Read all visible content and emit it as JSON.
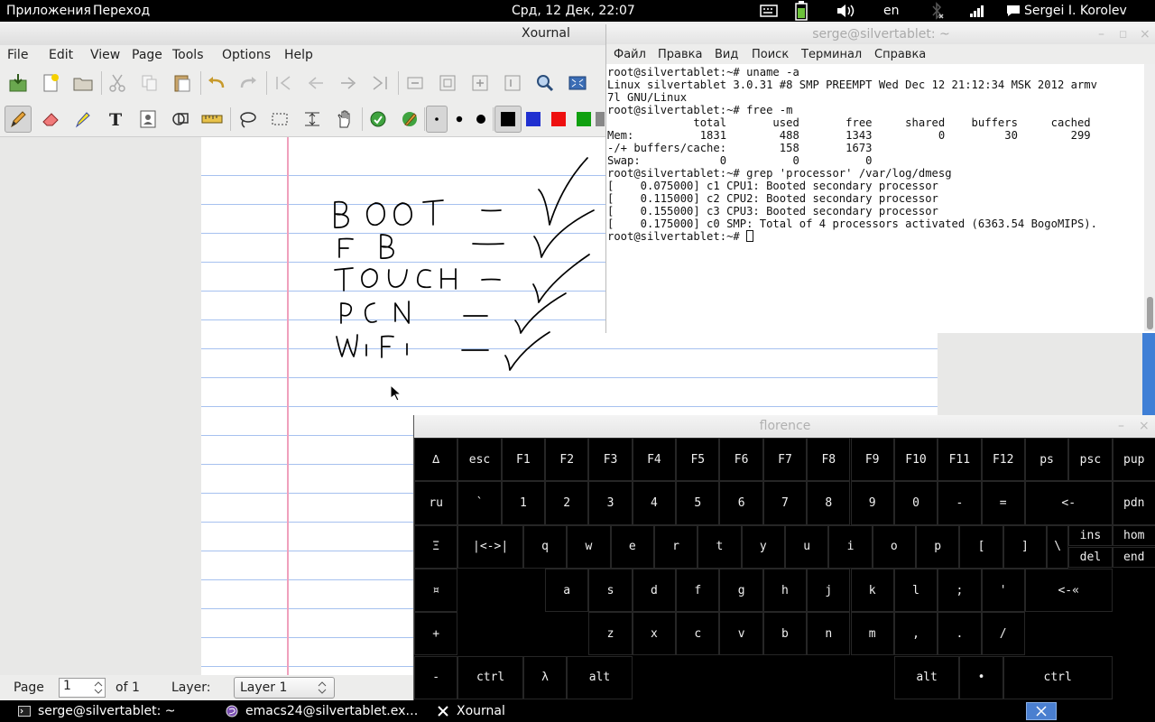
{
  "top_panel": {
    "applications": "Приложения",
    "places": "Переход",
    "clock": "Срд, 12 Дек, 22:07",
    "keyboard_layout": "en",
    "user": "Sergei I. Korolev"
  },
  "xournal": {
    "title": "Xournal",
    "menu": [
      "File",
      "Edit",
      "View",
      "Page",
      "Tools",
      "Options",
      "Help"
    ],
    "status": {
      "page_label": "Page",
      "page_value": "1",
      "of_label": "of 1",
      "layer_label": "Layer:",
      "layer_value": "Layer 1"
    },
    "colors": {
      "pen_black": "#000000",
      "blue": "#2030d0",
      "red": "#ee1010",
      "green": "#10a010"
    }
  },
  "terminal": {
    "title": "serge@silvertablet: ~",
    "menu": [
      "Файл",
      "Правка",
      "Вид",
      "Поиск",
      "Терминал",
      "Справка"
    ],
    "lines": [
      "root@silvertablet:~# uname -a",
      "Linux silvertablet 3.0.31 #8 SMP PREEMPT Wed Dec 12 21:12:34 MSK 2012 armv",
      "7l GNU/Linux",
      "root@silvertablet:~# free -m",
      "             total       used       free     shared    buffers     cached",
      "Mem:          1831        488       1343          0         30        299",
      "-/+ buffers/cache:        158       1673",
      "Swap:            0          0          0",
      "root@silvertablet:~# grep 'processor' /var/log/dmesg",
      "[    0.075000] c1 CPU1: Booted secondary processor",
      "[    0.115000] c2 CPU2: Booted secondary processor",
      "[    0.155000] c3 CPU3: Booted secondary processor",
      "[    0.175000] c0 SMP: Total of 4 processors activated (6363.54 BogoMIPS)."
    ],
    "prompt": "root@silvertablet:~# "
  },
  "florence": {
    "title": "florence",
    "rows": [
      [
        "∆",
        "esc",
        "F1",
        "F2",
        "F3",
        "F4",
        "F5",
        "F6",
        "F7",
        "F8",
        "F9",
        "F10",
        "F11",
        "F12",
        "ps",
        "psc",
        "pup"
      ],
      [
        "ru",
        "`",
        "1",
        "2",
        "3",
        "4",
        "5",
        "6",
        "7",
        "8",
        "9",
        "0",
        "-",
        "=",
        "<-",
        "pdn"
      ],
      [
        "Ξ",
        "|<->|",
        "q",
        "w",
        "e",
        "r",
        "t",
        "y",
        "u",
        "i",
        "o",
        "p",
        "[",
        "]",
        "\\",
        "ins",
        "del",
        "hom",
        "end"
      ],
      [
        "¤",
        "a",
        "s",
        "d",
        "f",
        "g",
        "h",
        "j",
        "k",
        "l",
        ";",
        "'",
        "<-«"
      ],
      [
        "+",
        "z",
        "x",
        "c",
        "v",
        "b",
        "n",
        "m",
        ",",
        ".",
        "/"
      ],
      [
        "-",
        "ctrl",
        "λ",
        "alt",
        "alt",
        "•",
        "ctrl"
      ]
    ]
  },
  "taskbar": {
    "items": [
      "serge@silvertablet: ~",
      "emacs24@silvertablet.ex…",
      "Xournal"
    ]
  }
}
